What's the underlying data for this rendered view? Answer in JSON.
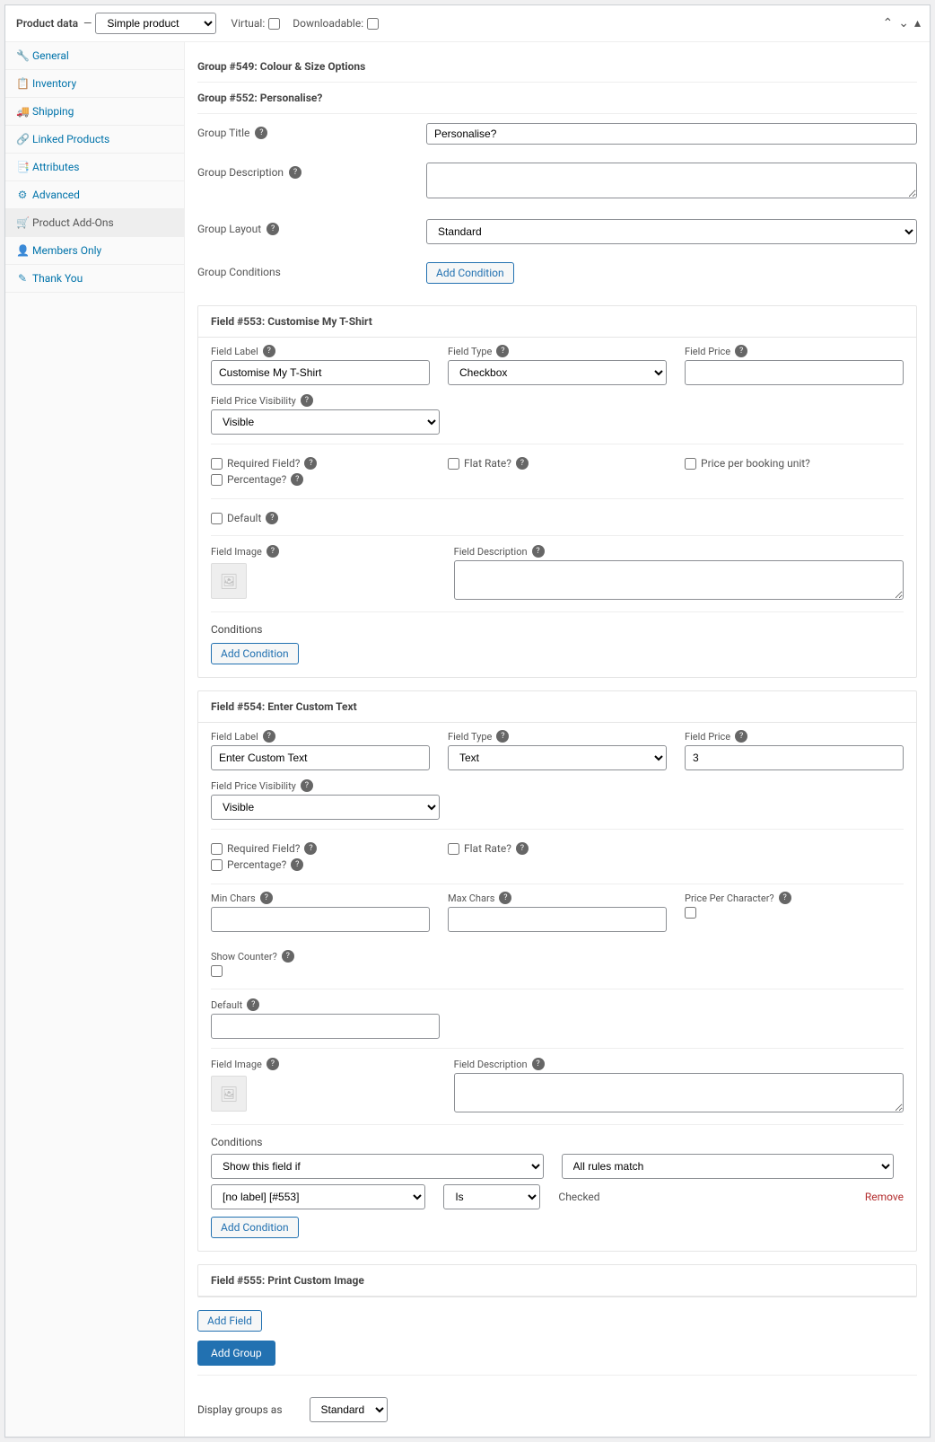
{
  "header": {
    "title": "Product data",
    "dash": "—",
    "product_type": "Simple product",
    "virtual_label": "Virtual:",
    "downloadable_label": "Downloadable:",
    "virtual_checked": false,
    "downloadable_checked": false
  },
  "tabs": [
    {
      "label": "General",
      "icon": "🔧"
    },
    {
      "label": "Inventory",
      "icon": "📋"
    },
    {
      "label": "Shipping",
      "icon": "🚚"
    },
    {
      "label": "Linked Products",
      "icon": "🔗"
    },
    {
      "label": "Attributes",
      "icon": "📑"
    },
    {
      "label": "Advanced",
      "icon": "⚙"
    },
    {
      "label": "Product Add-Ons",
      "icon": "🛒",
      "active": true
    },
    {
      "label": "Members Only",
      "icon": "👤"
    },
    {
      "label": "Thank You",
      "icon": "✎"
    }
  ],
  "group549": {
    "header": "Group #549: Colour & Size Options"
  },
  "group552": {
    "header": "Group #552: Personalise?",
    "labels": {
      "title": "Group Title",
      "desc": "Group Description",
      "layout": "Group Layout",
      "conditions": "Group Conditions"
    },
    "title_value": "Personalise?",
    "desc_value": "",
    "layout_value": "Standard",
    "add_condition": "Add Condition"
  },
  "field553": {
    "header": "Field #553: Customise My T-Shirt",
    "labels": {
      "field_label": "Field Label",
      "field_type": "Field Type",
      "field_price": "Field Price",
      "price_visibility": "Field Price Visibility",
      "required": "Required Field?",
      "flat_rate": "Flat Rate?",
      "price_per_booking": "Price per booking unit?",
      "percentage": "Percentage?",
      "default": "Default",
      "field_image": "Field Image",
      "field_description": "Field Description",
      "conditions": "Conditions"
    },
    "field_label_value": "Customise My T-Shirt",
    "field_type_value": "Checkbox",
    "field_price_value": "",
    "price_visibility_value": "Visible",
    "add_condition": "Add Condition"
  },
  "field554": {
    "header": "Field #554: Enter Custom Text",
    "labels": {
      "field_label": "Field Label",
      "field_type": "Field Type",
      "field_price": "Field Price",
      "price_visibility": "Field Price Visibility",
      "required": "Required Field?",
      "flat_rate": "Flat Rate?",
      "percentage": "Percentage?",
      "min_chars": "Min Chars",
      "max_chars": "Max Chars",
      "price_per_char": "Price Per Character?",
      "show_counter": "Show Counter?",
      "default": "Default",
      "field_image": "Field Image",
      "field_description": "Field Description",
      "conditions": "Conditions"
    },
    "field_label_value": "Enter Custom Text",
    "field_type_value": "Text",
    "field_price_value": "3",
    "price_visibility_value": "Visible",
    "cond_action": "Show this field if",
    "cond_match": "All rules match",
    "cond_field": "[no label] [#553]",
    "cond_op": "Is",
    "cond_value": "Checked",
    "remove": "Remove",
    "add_condition": "Add Condition"
  },
  "field555": {
    "header": "Field #555: Print Custom Image"
  },
  "buttons": {
    "add_field": "Add Field",
    "add_group": "Add Group"
  },
  "display": {
    "label": "Display groups as",
    "value": "Standard"
  }
}
